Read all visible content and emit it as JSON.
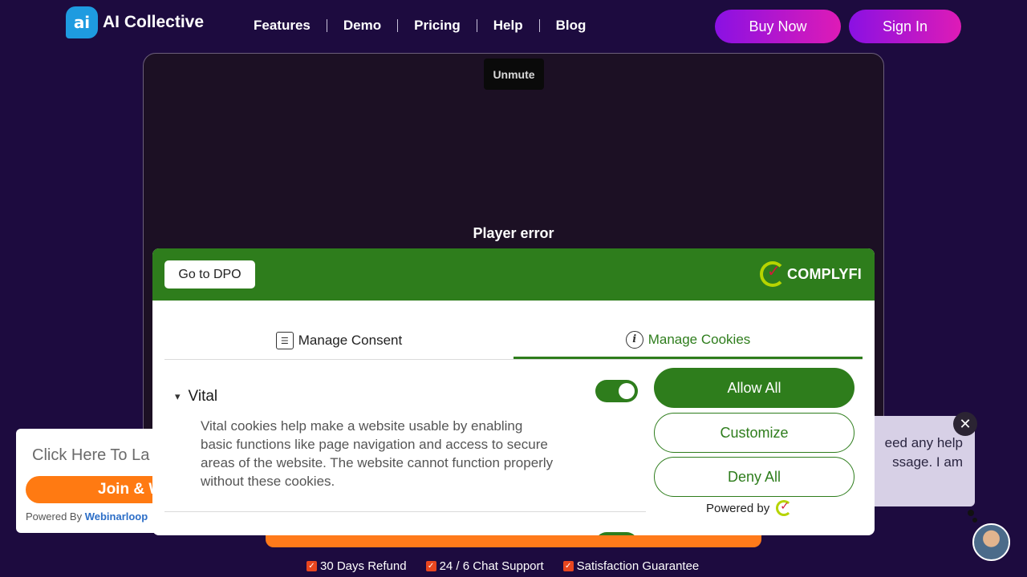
{
  "header": {
    "logo_mark": "ai",
    "logo_text": "AI Collective",
    "nav": [
      "Features",
      "Demo",
      "Pricing",
      "Help",
      "Blog"
    ],
    "buy_now": "Buy Now",
    "sign_in": "Sign In"
  },
  "video": {
    "unmute": "Unmute",
    "error": "Player error"
  },
  "cookie_modal": {
    "dpo_button": "Go to DPO",
    "brand": "COMPLYFI",
    "tabs": [
      {
        "label": "Manage Consent",
        "active": false
      },
      {
        "label": "Manage Cookies",
        "active": true
      }
    ],
    "section": {
      "title": "Vital",
      "enabled": true,
      "description": "Vital cookies help make a website usable by enabling basic functions like page navigation and access to secure areas of the website. The website cannot function properly without these cookies."
    },
    "actions": {
      "allow_all": "Allow All",
      "customize": "Customize",
      "deny_all": "Deny All"
    },
    "powered_by": "Powered by"
  },
  "webinar": {
    "title": "Click Here To La",
    "join": "Join & W",
    "powered_prefix": "Powered By ",
    "powered_brand": "Webinarloop"
  },
  "chat": {
    "message": "eed any help\nssage. I am",
    "close": "✕"
  },
  "guarantees": [
    "30 Days Refund",
    "24 / 6 Chat Support",
    "Satisfaction Guarantee"
  ],
  "colors": {
    "background": "#1d0b3f",
    "accent_gradient_start": "#8a11e3",
    "accent_gradient_end": "#de1bb6",
    "cookie_green": "#2e7d1c",
    "orange": "#ff7a1a"
  }
}
